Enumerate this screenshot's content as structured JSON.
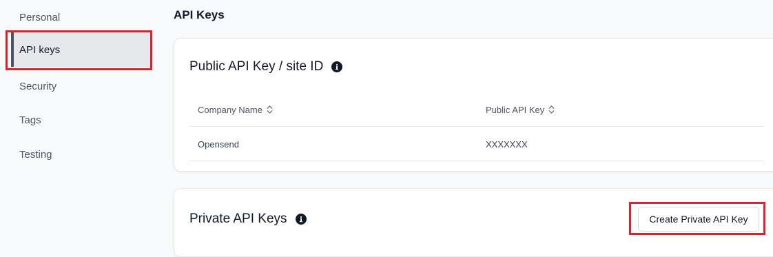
{
  "sidebar": {
    "items": [
      {
        "label": "Personal"
      },
      {
        "label": "API keys"
      },
      {
        "label": "Security"
      },
      {
        "label": "Tags"
      },
      {
        "label": "Testing"
      }
    ],
    "active_index": 1
  },
  "header": {
    "title": "API Keys"
  },
  "public_card": {
    "title": "Public API Key / site ID",
    "columns": [
      "Company Name",
      "Public API Key"
    ],
    "rows": [
      [
        "Opensend",
        "XXXXXXX"
      ]
    ]
  },
  "private_card": {
    "title": "Private API Keys",
    "create_button_label": "Create Private API Key"
  },
  "colors": {
    "highlight": "#e0202a",
    "active_bg": "#e5e7eb",
    "active_border": "#4b5563"
  },
  "icons": [
    "info-icon",
    "sort-icon"
  ]
}
